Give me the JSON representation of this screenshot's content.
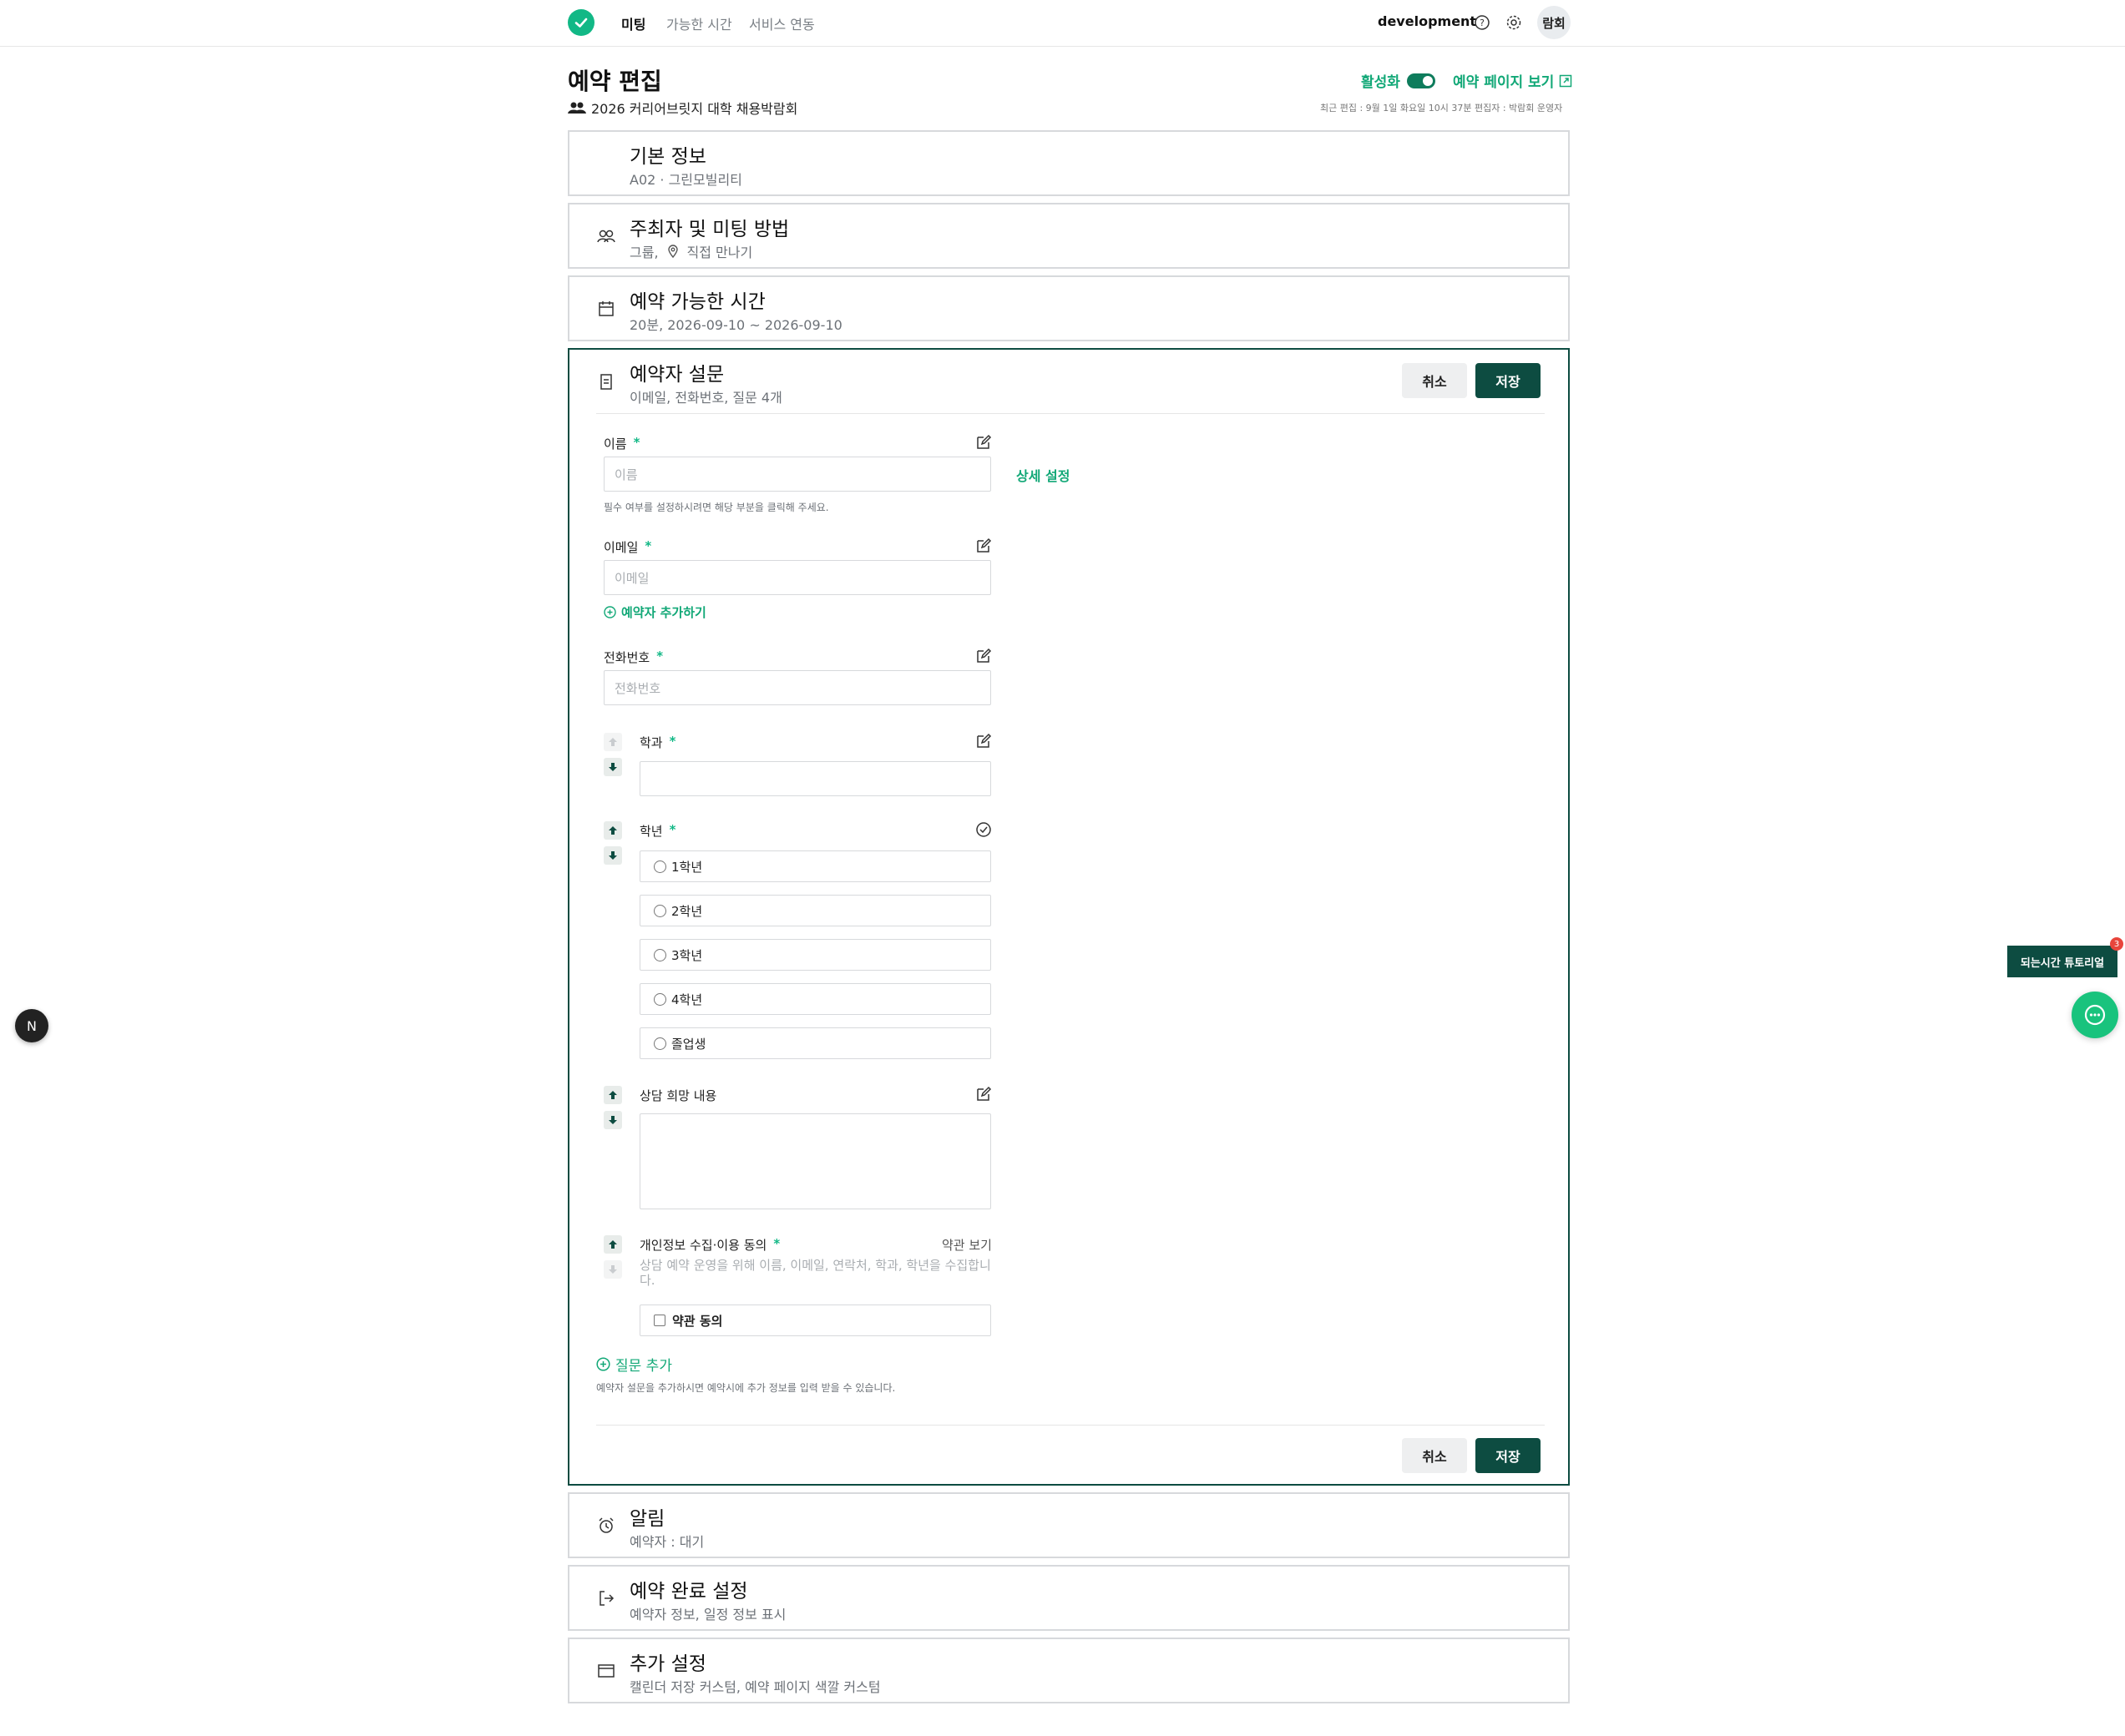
{
  "nav": {
    "items": [
      "미팅",
      "가능한 시간",
      "서비스 연동"
    ],
    "env": "development",
    "avatar": "람회"
  },
  "header": {
    "title": "예약 편집",
    "subtitle": "2026 커리어브릿지 대학 채용박람회",
    "active_label": "활성화",
    "view_page": "예약 페이지 보기",
    "last_edit": "최근 편집 : 9월 1일 화요일 10시 37분    편집자 : 박람회 운영자"
  },
  "sections": {
    "basic": {
      "title": "기본 정보",
      "sub": "A02 · 그린모빌리티"
    },
    "host": {
      "title": "주최자 및 미팅 방법",
      "sub_group": "그룹,",
      "sub_place": "직접 만나기"
    },
    "avail": {
      "title": "예약 가능한 시간",
      "sub": "20분,  2026-09-10 ~ 2026-09-10"
    },
    "survey": {
      "title": "예약자 설문",
      "sub": "이메일, 전화번호, 질문 4개"
    },
    "notify": {
      "title": "알림",
      "sub": "예약자 : 대기"
    },
    "complete": {
      "title": "예약 완료 설정",
      "sub": "예약자 정보, 일정 정보 표시"
    },
    "extra": {
      "title": "추가 설정",
      "sub": "캘린더 저장 커스텀, 예약 페이지 색깔 커스텀"
    }
  },
  "buttons": {
    "cancel": "취소",
    "save": "저장"
  },
  "survey": {
    "name": {
      "label": "이름",
      "placeholder": "이름",
      "detail": "상세 설정",
      "hint": "필수 여부를 설정하시려면 해당 부분을 클릭해 주세요."
    },
    "email": {
      "label": "이메일",
      "placeholder": "이메일",
      "add": "예약자 추가하기"
    },
    "phone": {
      "label": "전화번호",
      "placeholder": "전화번호"
    },
    "dept": {
      "label": "학과"
    },
    "grade": {
      "label": "학년",
      "options": [
        "1학년",
        "2학년",
        "3학년",
        "4학년",
        "졸업생"
      ]
    },
    "consult": {
      "label": "상담 희망 내용"
    },
    "privacy": {
      "label": "개인정보 수집·이용 동의",
      "terms": "약관 보기",
      "desc": "상담 예약 운영을 위해 이름, 이메일, 연락처, 학과, 학년을 수집합니다.",
      "agree": "약관 동의"
    },
    "add_question": "질문 추가",
    "add_hint": "예약자 설문을 추가하시면 예약시에 추가 정보를 입력 받을 수 있습니다."
  },
  "floating": {
    "n": "N",
    "tutorial": "되는시간 튜토리얼",
    "badge": "3"
  }
}
